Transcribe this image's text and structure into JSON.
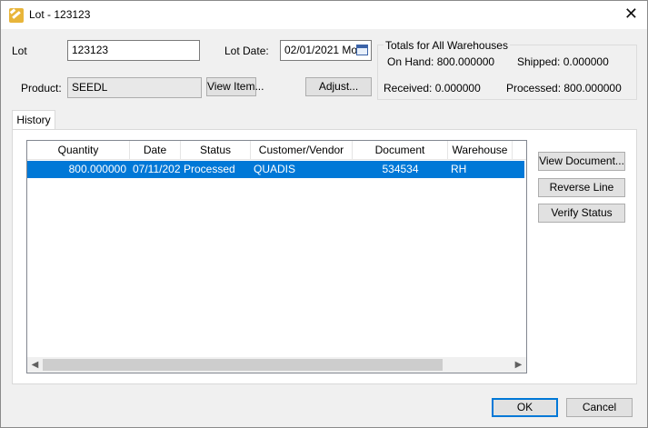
{
  "window": {
    "title": "Lot - 123123",
    "close_glyph": "✕"
  },
  "form": {
    "lot_label": "Lot",
    "lot_value": "123123",
    "lot_date_label": "Lot Date:",
    "lot_date_value": "02/01/2021 Mo",
    "product_label": "Product:",
    "product_value": "SEEDL",
    "view_item_label": "View Item...",
    "adjust_label": "Adjust..."
  },
  "totals": {
    "title": "Totals for All Warehouses",
    "on_hand": "On Hand: 800.000000",
    "shipped": "Shipped: 0.000000",
    "received": "Received: 0.000000",
    "processed": "Processed: 800.000000"
  },
  "tabs": {
    "history": "History"
  },
  "grid": {
    "columns": [
      "Quantity",
      "Date",
      "Status",
      "Customer/Vendor",
      "Document",
      "Warehouse"
    ],
    "rows": [
      {
        "quantity": "800.000000",
        "date": "07/11/202",
        "status": "Processed",
        "customer_vendor": "QUADIS",
        "document": "534534",
        "warehouse": "RH"
      }
    ]
  },
  "side_buttons": {
    "view_document": "View Document...",
    "reverse_line": "Reverse Line",
    "verify_status": "Verify Status"
  },
  "footer": {
    "ok": "OK",
    "cancel": "Cancel"
  },
  "colors": {
    "selection": "#0078d7",
    "accent_icon": "#e8b53a"
  },
  "icons": {
    "app": "lot-app-icon",
    "calendar": "calendar-icon",
    "scroll_left": "◀",
    "scroll_right": "▶"
  }
}
